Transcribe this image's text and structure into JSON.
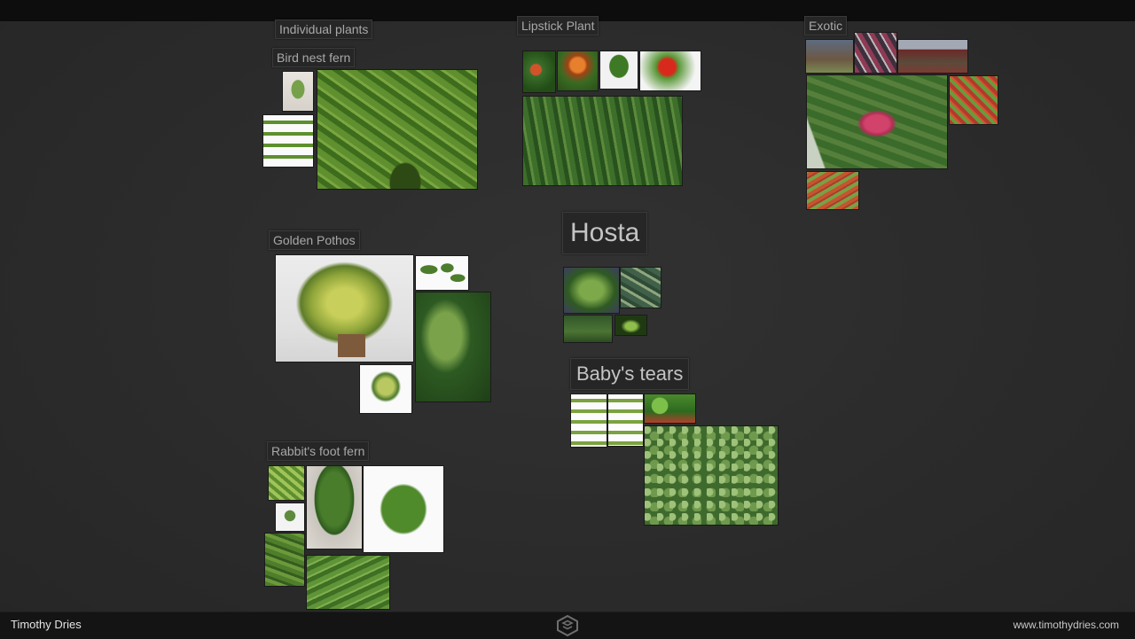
{
  "board": {
    "labels": {
      "individual": "Individual plants",
      "bird": "Bird nest fern",
      "lipstick": "Lipstick Plant",
      "exotic": "Exotic",
      "pothos": "Golden Pothos",
      "hosta": "Hosta",
      "tears": "Baby's tears",
      "rabbit": "Rabbit's foot fern"
    }
  },
  "footer": {
    "author": "Timothy Dries",
    "website": "www.timothydries.com"
  },
  "icons": {
    "logo": "artstation-logo-icon"
  }
}
